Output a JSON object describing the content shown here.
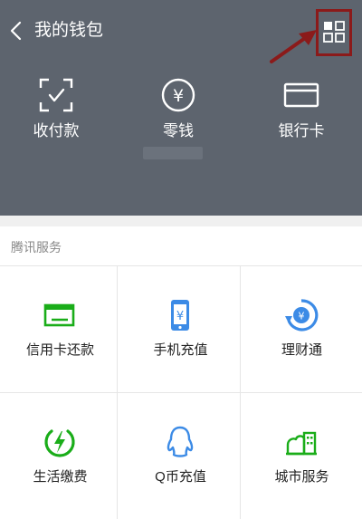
{
  "header": {
    "title": "我的钱包",
    "back_icon": "chevron-left-icon",
    "menu_icon": "grid-menu-icon",
    "highlight_color": "#8b1a1a"
  },
  "top_items": [
    {
      "label": "收付款",
      "icon": "scan-pay-icon"
    },
    {
      "label": "零钱",
      "icon": "yuan-coin-icon"
    },
    {
      "label": "银行卡",
      "icon": "bank-card-icon"
    }
  ],
  "services": {
    "title": "腾讯服务",
    "accent": "#1aad19",
    "items": [
      {
        "label": "信用卡还款",
        "icon": "credit-card-repay-icon"
      },
      {
        "label": "手机充值",
        "icon": "phone-topup-icon"
      },
      {
        "label": "理财通",
        "icon": "wealth-icon"
      },
      {
        "label": "生活缴费",
        "icon": "utility-bill-icon"
      },
      {
        "label": "Q币充值",
        "icon": "q-coin-icon"
      },
      {
        "label": "城市服务",
        "icon": "city-service-icon"
      }
    ]
  },
  "colors": {
    "header_bg": "#5d646e",
    "primary_green": "#1aad19",
    "blue": "#3c8be6"
  }
}
